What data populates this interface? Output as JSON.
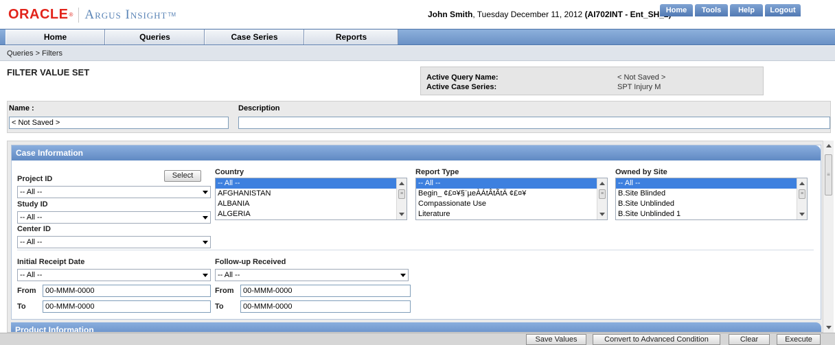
{
  "header": {
    "brand": "ORACLE",
    "product": "Argus Insight",
    "product_tm": "TM",
    "user_name": "John Smith",
    "date_text": ", Tuesday December 11, 2012 ",
    "context": "(AI702INT - Ent_SH_2)",
    "links": [
      "Home",
      "Tools",
      "Help",
      "Logout"
    ]
  },
  "menu": [
    "Home",
    "Queries",
    "Case Series",
    "Reports"
  ],
  "breadcrumb": "Queries > Filters",
  "page_title": "FILTER VALUE SET",
  "active": {
    "query_label": "Active Query Name:",
    "query_value": "< Not Saved >",
    "series_label": "Active Case Series:",
    "series_value": "SPT Injury M"
  },
  "name_panel": {
    "name_label": "Name :",
    "name_value": "< Not Saved >",
    "desc_label": "Description",
    "desc_value": ""
  },
  "case_info": {
    "title": "Case Information",
    "project_label": "Project ID",
    "select_button": "Select",
    "project_value": "-- All --",
    "study_label": "Study ID",
    "study_value": "-- All --",
    "center_label": "Center ID",
    "center_value": "-- All --",
    "country_label": "Country",
    "country_options": [
      "-- All --",
      "AFGHANISTAN",
      "ALBANIA",
      "ALGERIA"
    ],
    "report_type_label": "Report Type",
    "report_type_options": [
      "-- All --",
      "Begin_ ¢£¤¥§¨µeÀÁtÂtÃtÄ ¢£¤¥",
      "Compassionate Use",
      "Literature"
    ],
    "owned_label": "Owned by Site",
    "owned_options": [
      "-- All --",
      "B.Site Blinded",
      "B.Site Unblinded",
      "B.Site Unblinded 1"
    ],
    "initial_label": "Initial Receipt Date",
    "initial_value": "-- All --",
    "followup_label": "Follow-up Received",
    "followup_value": "-- All --",
    "from_label": "From",
    "to_label": "To",
    "date_placeholder": "00-MMM-0000"
  },
  "product_info": {
    "title": "Product Information"
  },
  "footer": {
    "buttons": [
      "Save Values",
      "Convert to Advanced Condition",
      "Clear",
      "Execute"
    ]
  },
  "colors": {
    "brand_red": "#e2241b",
    "accent_blue": "#5f89c3",
    "selection_blue": "#3d80df"
  }
}
